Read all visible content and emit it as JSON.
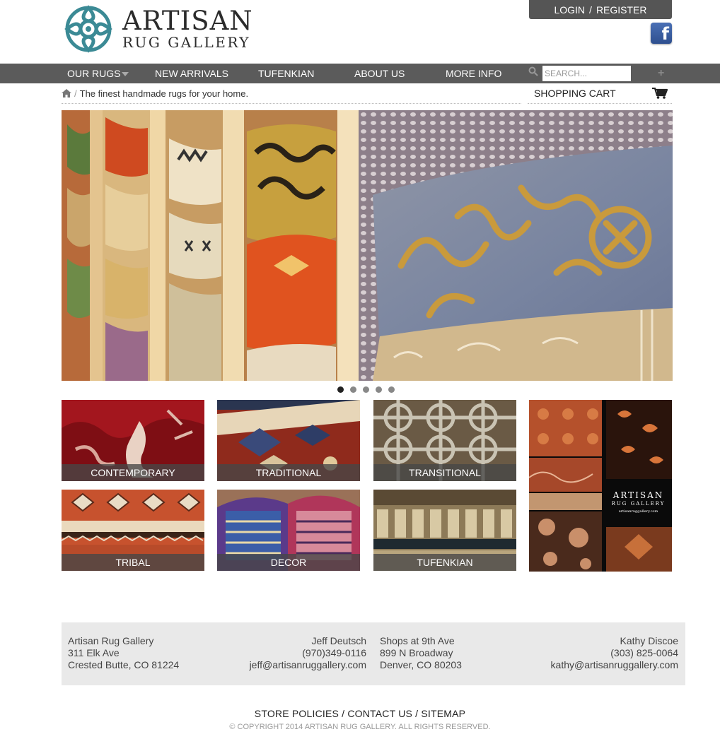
{
  "brand": {
    "line1": "ARTISAN",
    "line2": "RUG GALLERY"
  },
  "account": {
    "login": "LOGIN",
    "separator": "/",
    "register": "REGISTER"
  },
  "social": {
    "facebook_glyph": "f"
  },
  "nav": {
    "items": [
      {
        "label": "OUR RUGS"
      },
      {
        "label": "NEW ARRIVALS"
      },
      {
        "label": "TUFENKIAN"
      },
      {
        "label": "ABOUT US"
      },
      {
        "label": "MORE INFO"
      }
    ],
    "search_placeholder": "SEARCH...",
    "plus": "+"
  },
  "breadcrumb": {
    "separator": "/",
    "tagline": "The finest handmade rugs for your home."
  },
  "cart": {
    "label": "SHOPPING CART"
  },
  "slider": {
    "slide_count": 5,
    "active_index": 0
  },
  "categories": [
    {
      "label": "CONTEMPORARY"
    },
    {
      "label": "TRADITIONAL"
    },
    {
      "label": "TRANSITIONAL"
    },
    {
      "label": "TRIBAL"
    },
    {
      "label": "DECOR"
    },
    {
      "label": "TUFENKIAN"
    }
  ],
  "promo": {
    "line1": "ARTISAN",
    "line2": "RUG GALLERY",
    "line3": "artisanruggallery.com"
  },
  "footer": {
    "store1": {
      "name": "Artisan Rug Gallery",
      "street": "311 Elk Ave",
      "city": "Crested Butte, CO 81224"
    },
    "contact1": {
      "name": "Jeff Deutsch",
      "phone": "(970)349-0116",
      "email": "jeff@artisanruggallery.com"
    },
    "store2": {
      "name": "Shops at 9th Ave",
      "street": "899 N Broadway",
      "city": "Denver, CO 80203"
    },
    "contact2": {
      "name": "Kathy Discoe",
      "phone": "(303) 825-0064",
      "email": "kathy@artisanruggallery.com"
    }
  },
  "footer_links": {
    "policies": "STORE POLICIES",
    "contact": "CONTACT US",
    "sitemap": "SITEMAP",
    "separator": "/"
  },
  "copyright": "© COPYRIGHT 2014 ARTISAN RUG GALLERY. ALL RIGHTS RESERVED."
}
